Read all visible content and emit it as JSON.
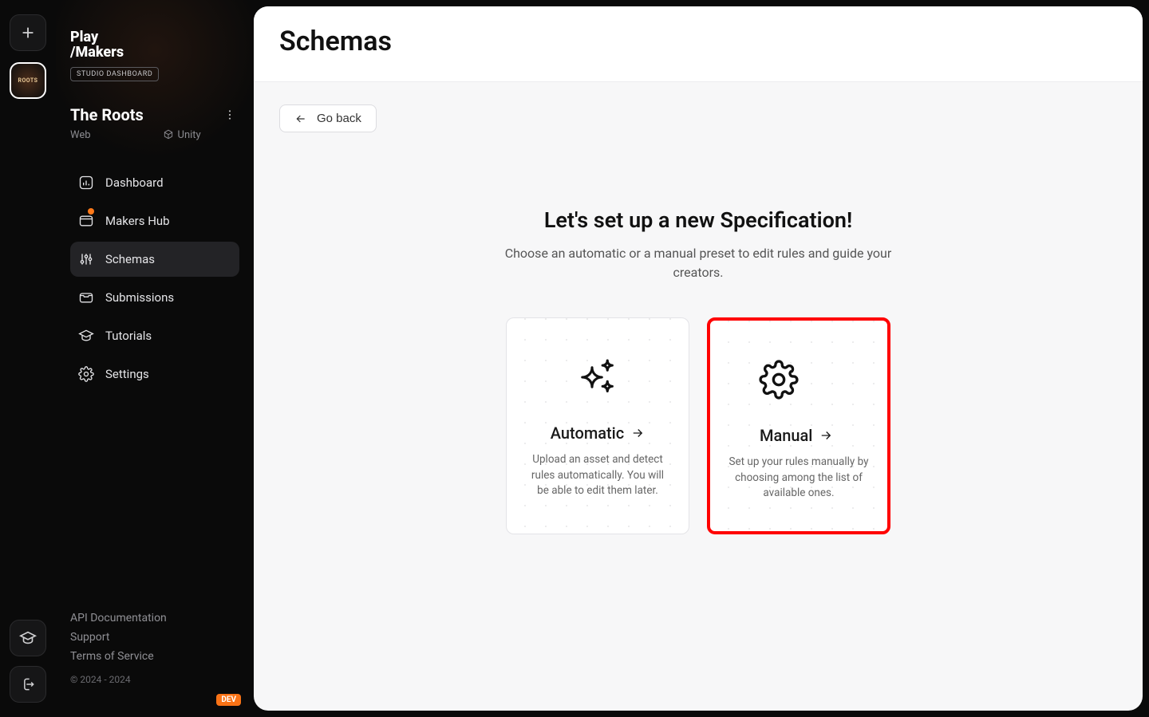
{
  "brand": {
    "line1": "Play",
    "line2": "/Makers",
    "badge": "STUDIO DASHBOARD"
  },
  "project": {
    "name": "The Roots",
    "platform": "Web",
    "engine": "Unity",
    "rail_label": "ROOTS"
  },
  "nav": {
    "dashboard": "Dashboard",
    "makers_hub": "Makers Hub",
    "schemas": "Schemas",
    "submissions": "Submissions",
    "tutorials": "Tutorials",
    "settings": "Settings"
  },
  "footer": {
    "api": "API Documentation",
    "support": "Support",
    "tos": "Terms of Service",
    "copyright": "© 2024 - 2024",
    "dev": "DEV"
  },
  "page": {
    "title": "Schemas",
    "go_back": "Go back",
    "setup_title": "Let's set up a new Specification!",
    "setup_sub": "Choose an automatic or a manual preset to edit rules and guide your creators."
  },
  "cards": {
    "auto": {
      "title": "Automatic",
      "desc": "Upload an asset and detect rules automatically. You will be able to edit them later."
    },
    "manual": {
      "title": "Manual",
      "desc": "Set up your rules manually by choosing among the list of available ones."
    }
  }
}
